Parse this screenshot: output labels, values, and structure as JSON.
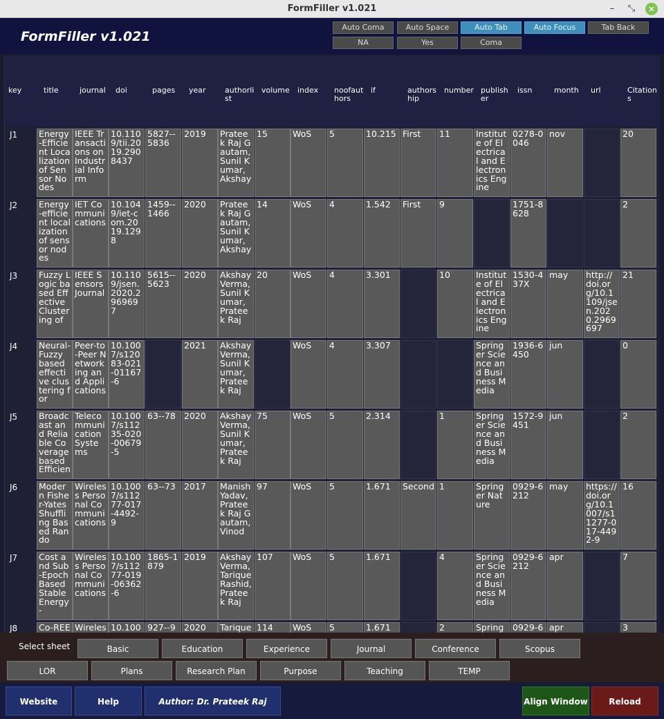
{
  "window": {
    "title": "FormFiller v1.021"
  },
  "app": {
    "title": "FormFiller v1.021"
  },
  "toolbar": {
    "auto_coma": "Auto Coma",
    "auto_space": "Auto Space",
    "auto_tab": "Auto Tab",
    "auto_focus": "Auto Focus",
    "tab_back": "Tab Back",
    "na": "NA",
    "yes": "Yes",
    "coma": "Coma"
  },
  "table": {
    "headers": [
      "key",
      "title",
      "journal",
      "doi",
      "pages",
      "year",
      "authorlist",
      "volume",
      "index",
      "noofauthors",
      "if",
      "authorship",
      "number",
      "publisher",
      "issn",
      "month",
      "url",
      "Citations"
    ],
    "rows": [
      {
        "key": "J1",
        "cells": [
          "Energy-Efficient Localization of Sensor Nodes",
          "IEEE Transactions on Industrial Inform",
          "10.1109/tii.2019.2908437",
          "5827--5836",
          "2019",
          "Prateek Raj Gautam,Sunil Kumar, Akshay",
          "15",
          "WoS",
          "5",
          "10.215",
          "First",
          "11",
          "Institute of Electrical and Electronics Engine",
          "0278-0046",
          "nov",
          "",
          "20"
        ]
      },
      {
        "key": "J2",
        "cells": [
          "Energy-efficient localization of sensor nodes",
          "IET Communications",
          "10.1049/iet-com.2019.1298",
          "1459--1466",
          "2020",
          "Prateek Raj Gautam,Sunil Kumar, Akshay",
          "14",
          "WoS",
          "4",
          "1.542",
          "First",
          "9",
          "",
          "1751-8628",
          "",
          "",
          "2"
        ]
      },
      {
        "key": "J3",
        "cells": [
          "Fuzzy Logic based Effective Clustering of",
          "IEEE Sensors Journal",
          "10.1109/jsen.2020.2969697",
          "5615--5623",
          "2020",
          "Akshay Verma, Sunil Kumar, Prateek Raj",
          "20",
          "WoS",
          "4",
          "3.301",
          "",
          "10",
          "Institute of Electrical and Electronics Engine",
          "1530-437X",
          "may",
          "http://doi.org/10.1109/jsen.2020.2969697",
          "21"
        ]
      },
      {
        "key": "J4",
        "cells": [
          "Neural-Fuzzy based effective clustering for",
          "Peer-to-Peer Networking and Applications",
          "10.1007/s12083-021-01167-6",
          "",
          "2021",
          "Akshay Verma, Sunil Kumar, Prateek Raj",
          "",
          "WoS",
          "4",
          "3.307",
          "",
          "",
          "Springer Science and Business Media",
          "1936-6450",
          "jun",
          "",
          "0"
        ]
      },
      {
        "key": "J5",
        "cells": [
          "Broadcast and Reliable Coverage based Efficien",
          "Telecommunication Systems",
          "10.1007/s11235-020-00679-5",
          "63--78",
          "2020",
          "Akshay Verma, Sunil Kumar, Prateek Raj",
          "75",
          "WoS",
          "5",
          "2.314",
          "",
          "1",
          "Springer Science and Business Media",
          "1572-9451",
          "jun",
          "",
          "2"
        ]
      },
      {
        "key": "J6",
        "cells": [
          "Modern Fisher-Yates Shuffling Based Rando",
          "Wireless Personal Communications",
          "10.1007/s11277-017-4492-9",
          "63--73",
          "2017",
          "Manish Yadav, Prateek Raj Gautam,Vinod",
          "97",
          "WoS",
          "5",
          "1.671",
          "Second",
          "1",
          "Springer Nature",
          "0929-6212",
          "may",
          "https://doi.org/10.1007/s11277-017-4492-9",
          "16"
        ]
      },
      {
        "key": "J7",
        "cells": [
          "Cost and Sub-Epoch Based Stable Energy-",
          "Wireless Personal Communications",
          "10.1007/s11277-019-06362-6",
          "1865-1879",
          "2019",
          "Akshay Verma, Tarique Rashid, Prateek Raj",
          "107",
          "WoS",
          "5",
          "1.671",
          "",
          "4",
          "Springer Science and Business Media",
          "0929-6212",
          "apr",
          "",
          "7"
        ]
      },
      {
        "key": "J8",
        "cells": [
          "Co-REE",
          "Wireless",
          "10.100",
          "927--94",
          "2020",
          "Tarique",
          "114",
          "WoS",
          "5",
          "1.671",
          "",
          "2",
          "Springe",
          "0929-6",
          "apr",
          "",
          "3"
        ]
      }
    ]
  },
  "sheets": {
    "label": "Select sheet",
    "row1": [
      "Basic",
      "Education",
      "Experience",
      "Journal",
      "Conference",
      "Scopus"
    ],
    "row2": [
      "LOR",
      "Plans",
      "Research Plan",
      "Purpose",
      "Teaching Statement",
      "TEMP"
    ]
  },
  "footer": {
    "website": "Website",
    "help": "Help",
    "author": "Author: Dr. Prateek Raj Gautam",
    "align": "Align Window",
    "reload": "Reload"
  }
}
